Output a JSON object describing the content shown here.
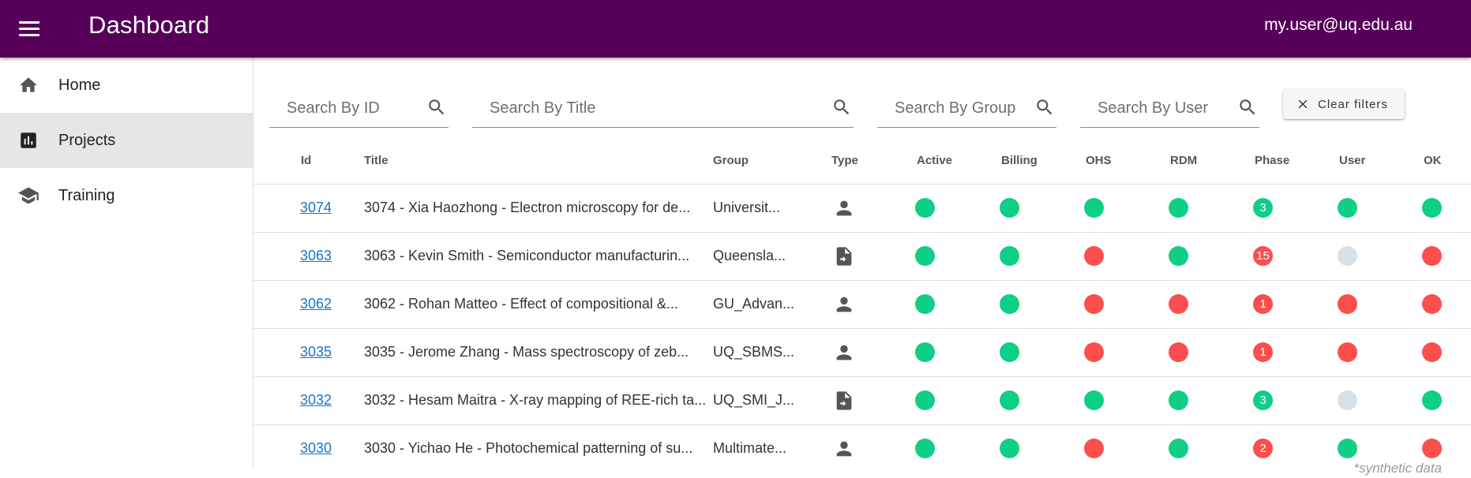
{
  "app": {
    "title": "Dashboard",
    "user_email": "my.user@uq.edu.au"
  },
  "sidebar": {
    "items": [
      {
        "label": "Home",
        "icon": "home-icon",
        "active": false
      },
      {
        "label": "Projects",
        "icon": "bar-chart-icon",
        "active": true
      },
      {
        "label": "Training",
        "icon": "school-icon",
        "active": false
      }
    ]
  },
  "filters": {
    "id_placeholder": "Search By ID",
    "title_placeholder": "Search By Title",
    "group_placeholder": "Search By Group",
    "user_placeholder": "Search By User",
    "clear_label": "Clear filters"
  },
  "table": {
    "headers": [
      "Id",
      "Title",
      "Group",
      "Type",
      "Active",
      "Billing",
      "OHS",
      "RDM",
      "Phase",
      "User",
      "OK"
    ],
    "rows": [
      {
        "id": "3074",
        "title": "3074 - Xia Haozhong - Electron microscopy for de...",
        "group": "Universit...",
        "type": "person",
        "active": "green",
        "billing": "green",
        "ohs": "green",
        "rdm": "green",
        "phase": {
          "value": "3",
          "status": "green"
        },
        "user": "green",
        "ok": "green"
      },
      {
        "id": "3063",
        "title": "3063 - Kevin Smith - Semiconductor manufacturin...",
        "group": "Queensla...",
        "type": "document",
        "active": "green",
        "billing": "green",
        "ohs": "red",
        "rdm": "green",
        "phase": {
          "value": "15",
          "status": "red"
        },
        "user": "grey",
        "ok": "red"
      },
      {
        "id": "3062",
        "title": "3062 - Rohan Matteo - Effect of compositional &...",
        "group": "GU_Advan...",
        "type": "person",
        "active": "green",
        "billing": "green",
        "ohs": "red",
        "rdm": "red",
        "phase": {
          "value": "1",
          "status": "red"
        },
        "user": "red",
        "ok": "red"
      },
      {
        "id": "3035",
        "title": "3035 - Jerome Zhang - Mass spectroscopy of zeb...",
        "group": "UQ_SBMS...",
        "type": "person",
        "active": "green",
        "billing": "green",
        "ohs": "red",
        "rdm": "red",
        "phase": {
          "value": "1",
          "status": "red"
        },
        "user": "red",
        "ok": "red"
      },
      {
        "id": "3032",
        "title": "3032 - Hesam Maitra - X-ray mapping of REE-rich ta...",
        "group": "UQ_SMI_J...",
        "type": "document",
        "active": "green",
        "billing": "green",
        "ohs": "green",
        "rdm": "green",
        "phase": {
          "value": "3",
          "status": "green"
        },
        "user": "grey",
        "ok": "green"
      },
      {
        "id": "3030",
        "title": "3030 - Yichao He - Photochemical patterning of su...",
        "group": "Multimate...",
        "type": "person",
        "active": "green",
        "billing": "green",
        "ohs": "red",
        "rdm": "green",
        "phase": {
          "value": "2",
          "status": "red"
        },
        "user": "green",
        "ok": "red"
      }
    ]
  },
  "colors": {
    "green": "#0fcf84",
    "red": "#fb4e4e",
    "grey": "#d6e1ea",
    "brand": "#56005a",
    "link": "#1a73c9"
  },
  "footnote": "*synthetic data"
}
